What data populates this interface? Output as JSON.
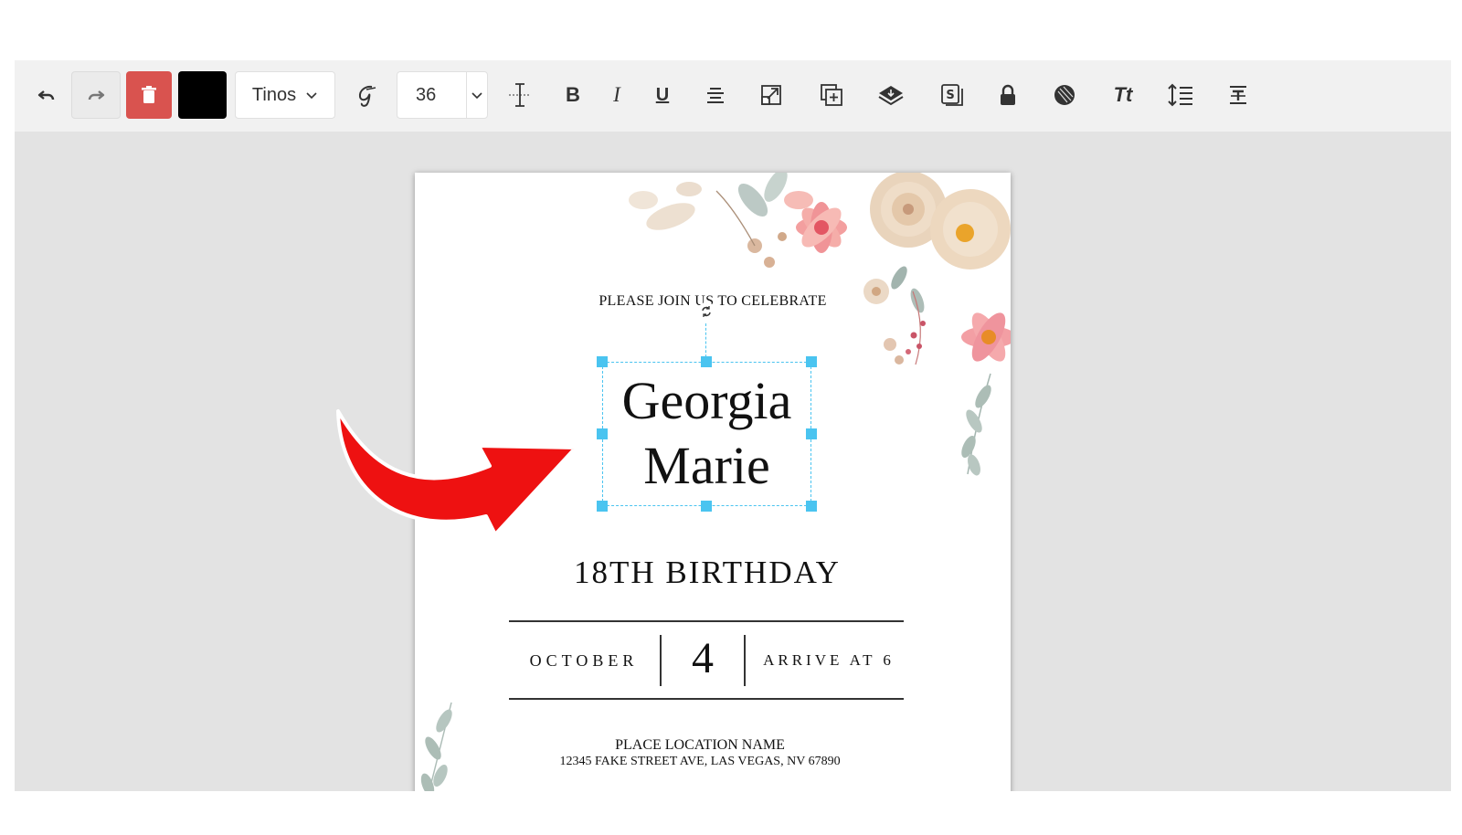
{
  "toolbar": {
    "undo_icon": "undo-icon",
    "redo_icon": "redo-icon",
    "delete_icon": "trash-icon",
    "text_color": "#000000",
    "font_family": "Tinos",
    "font_size": "36",
    "icons": [
      "script-font-icon",
      "text-spacing-icon",
      "bold-icon",
      "italic-icon",
      "underline-icon",
      "align-center-icon",
      "resize-icon",
      "duplicate-icon",
      "layers-icon",
      "stamp-icon",
      "lock-icon",
      "opacity-icon",
      "text-case-icon",
      "line-height-icon",
      "text-position-icon"
    ]
  },
  "card": {
    "intro": "PLEASE JOIN US TO CELEBRATE",
    "name_line1": "Georgia",
    "name_line2": "Marie",
    "occasion": "18TH BIRTHDAY",
    "month": "OCTOBER",
    "day": "4",
    "arrival": "ARRIVE AT 6",
    "location": "PLACE LOCATION NAME",
    "address": "12345 FAKE STREET AVE, LAS VEGAS, NV 67890"
  },
  "colors": {
    "selection": "#4ac4f0",
    "delete": "#d9534f",
    "arrow": "#ee1111"
  }
}
